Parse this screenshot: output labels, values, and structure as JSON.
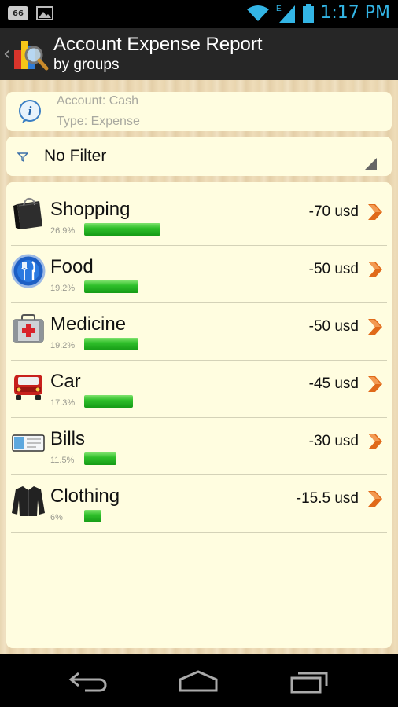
{
  "status_bar": {
    "notification_badge": "66",
    "time": "1:17 PM",
    "network_type": "E",
    "accent_color": "#33b5e5"
  },
  "action_bar": {
    "title": "Account Expense Report",
    "subtitle": "by groups"
  },
  "info": {
    "account_line": "Account: Cash",
    "type_line": "Type: Expense"
  },
  "filter": {
    "value": "No Filter"
  },
  "groups": [
    {
      "name": "Shopping",
      "percent": "26.9%",
      "amount": "-70 usd",
      "share": 0.269,
      "icon": "shopping-bag-icon"
    },
    {
      "name": "Food",
      "percent": "19.2%",
      "amount": "-50 usd",
      "share": 0.192,
      "icon": "fork-knife-icon"
    },
    {
      "name": "Medicine",
      "percent": "19.2%",
      "amount": "-50 usd",
      "share": 0.192,
      "icon": "first-aid-kit-icon"
    },
    {
      "name": "Car",
      "percent": "17.3%",
      "amount": "-45 usd",
      "share": 0.173,
      "icon": "truck-icon"
    },
    {
      "name": "Bills",
      "percent": "11.5%",
      "amount": "-30 usd",
      "share": 0.115,
      "icon": "cheque-icon"
    },
    {
      "name": "Clothing",
      "percent": "6%",
      "amount": "-15.5 usd",
      "share": 0.06,
      "icon": "jacket-icon"
    }
  ],
  "colors": {
    "bar_green": "#2fbf2a",
    "chevron_orange": "#e06a1a",
    "card_bg": "#fffde0"
  }
}
